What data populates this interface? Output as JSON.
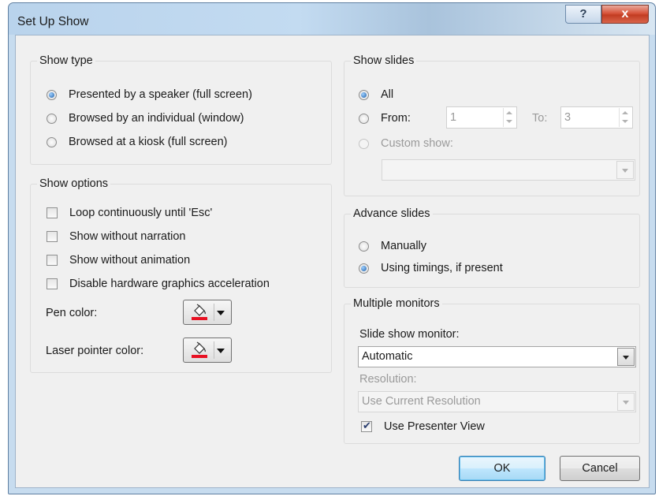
{
  "window": {
    "title": "Set Up Show",
    "help_label": "?",
    "close_label": "x"
  },
  "show_type": {
    "legend": "Show type",
    "options": [
      {
        "label": "Presented by a speaker (full screen)",
        "checked": true
      },
      {
        "label": "Browsed by an individual (window)",
        "checked": false
      },
      {
        "label": "Browsed at a kiosk (full screen)",
        "checked": false
      }
    ]
  },
  "show_options": {
    "legend": "Show options",
    "checkboxes": [
      {
        "label": "Loop continuously until 'Esc'",
        "checked": false
      },
      {
        "label": "Show without narration",
        "checked": false
      },
      {
        "label": "Show without animation",
        "checked": false
      },
      {
        "label": "Disable hardware graphics acceleration",
        "checked": false
      }
    ],
    "pen_color_label": "Pen color:",
    "laser_color_label": "Laser pointer color:",
    "pen_color": "#e81123",
    "laser_color": "#e81123"
  },
  "show_slides": {
    "legend": "Show slides",
    "all_label": "All",
    "from_label": "From:",
    "from_value": "1",
    "to_label": "To:",
    "to_value": "3",
    "custom_show_label": "Custom show:",
    "custom_show_value": "",
    "selected": "All"
  },
  "advance_slides": {
    "legend": "Advance slides",
    "manually_label": "Manually",
    "timings_label": "Using timings, if present",
    "selected": "Using timings, if present"
  },
  "multiple_monitors": {
    "legend": "Multiple monitors",
    "monitor_label": "Slide show monitor:",
    "monitor_value": "Automatic",
    "resolution_label": "Resolution:",
    "resolution_value": "Use Current Resolution",
    "presenter_view_label": "Use Presenter View",
    "presenter_view_checked": true
  },
  "buttons": {
    "ok": "OK",
    "cancel": "Cancel"
  },
  "colors": {
    "accent": "#1e5fa8",
    "title_bar": "#c3dbf1",
    "dialog_bg": "#f0f0f0"
  }
}
